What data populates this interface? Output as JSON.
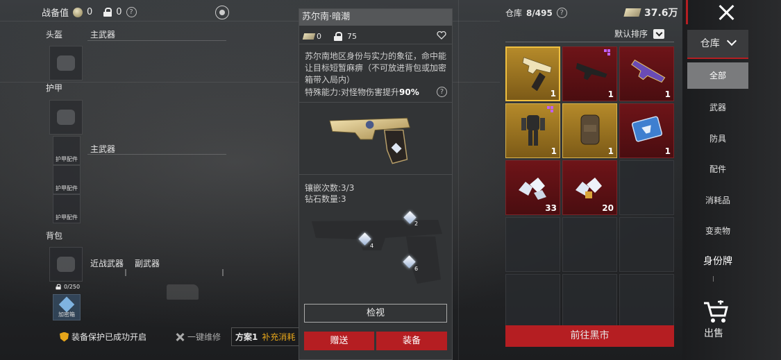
{
  "top_stats": {
    "label": "战备值",
    "coin_value": "0",
    "lock_value": "0"
  },
  "loadout": {
    "helmet": "头盔",
    "armor": "护甲",
    "armor_acc": [
      "护甲配件",
      "护甲配件",
      "护甲配件"
    ],
    "backpack": "背包",
    "backpack_cap": "0/250",
    "secure": "加密箱",
    "primary1": "主武器",
    "primary2": "主武器",
    "melee": "近战武器",
    "secondary": "副武器"
  },
  "bottom_bar": {
    "protect": "装备保护已成功开启",
    "repair": "一键维修",
    "plan": "方案1",
    "restock": "补充消耗"
  },
  "item": {
    "name": "苏尔南·暗潮",
    "price": "0",
    "weight": "75",
    "desc": "苏尔南地区身份与实力的象征，命中能让目标短暂麻痹（不可放进背包或加密箱带入局内）",
    "special_prefix": "特殊能力:对怪物伤害提升",
    "special_value": "90%",
    "inlay": "镶嵌次数:3/3",
    "diamonds": "钻石数量:3",
    "diamond_nums": [
      "2",
      "4",
      "6"
    ],
    "inspect": "检视",
    "gift": "赠送",
    "equip": "装备"
  },
  "warehouse": {
    "label": "仓库",
    "capacity": "8/495",
    "money": "37.6万",
    "sort": "默认排序",
    "counts": [
      "1",
      "1",
      "1",
      "1",
      "1",
      "1",
      "33",
      "20"
    ],
    "black_market": "前往黑市"
  },
  "nav": {
    "head": "仓库",
    "items": [
      "全部",
      "武器",
      "防具",
      "配件",
      "消耗品",
      "变卖物",
      "身份牌"
    ],
    "sell": "出售"
  },
  "colors": {
    "accent_red": "#b51e22",
    "gold": "#b58a2a",
    "purple_pip": "#c060ff"
  }
}
